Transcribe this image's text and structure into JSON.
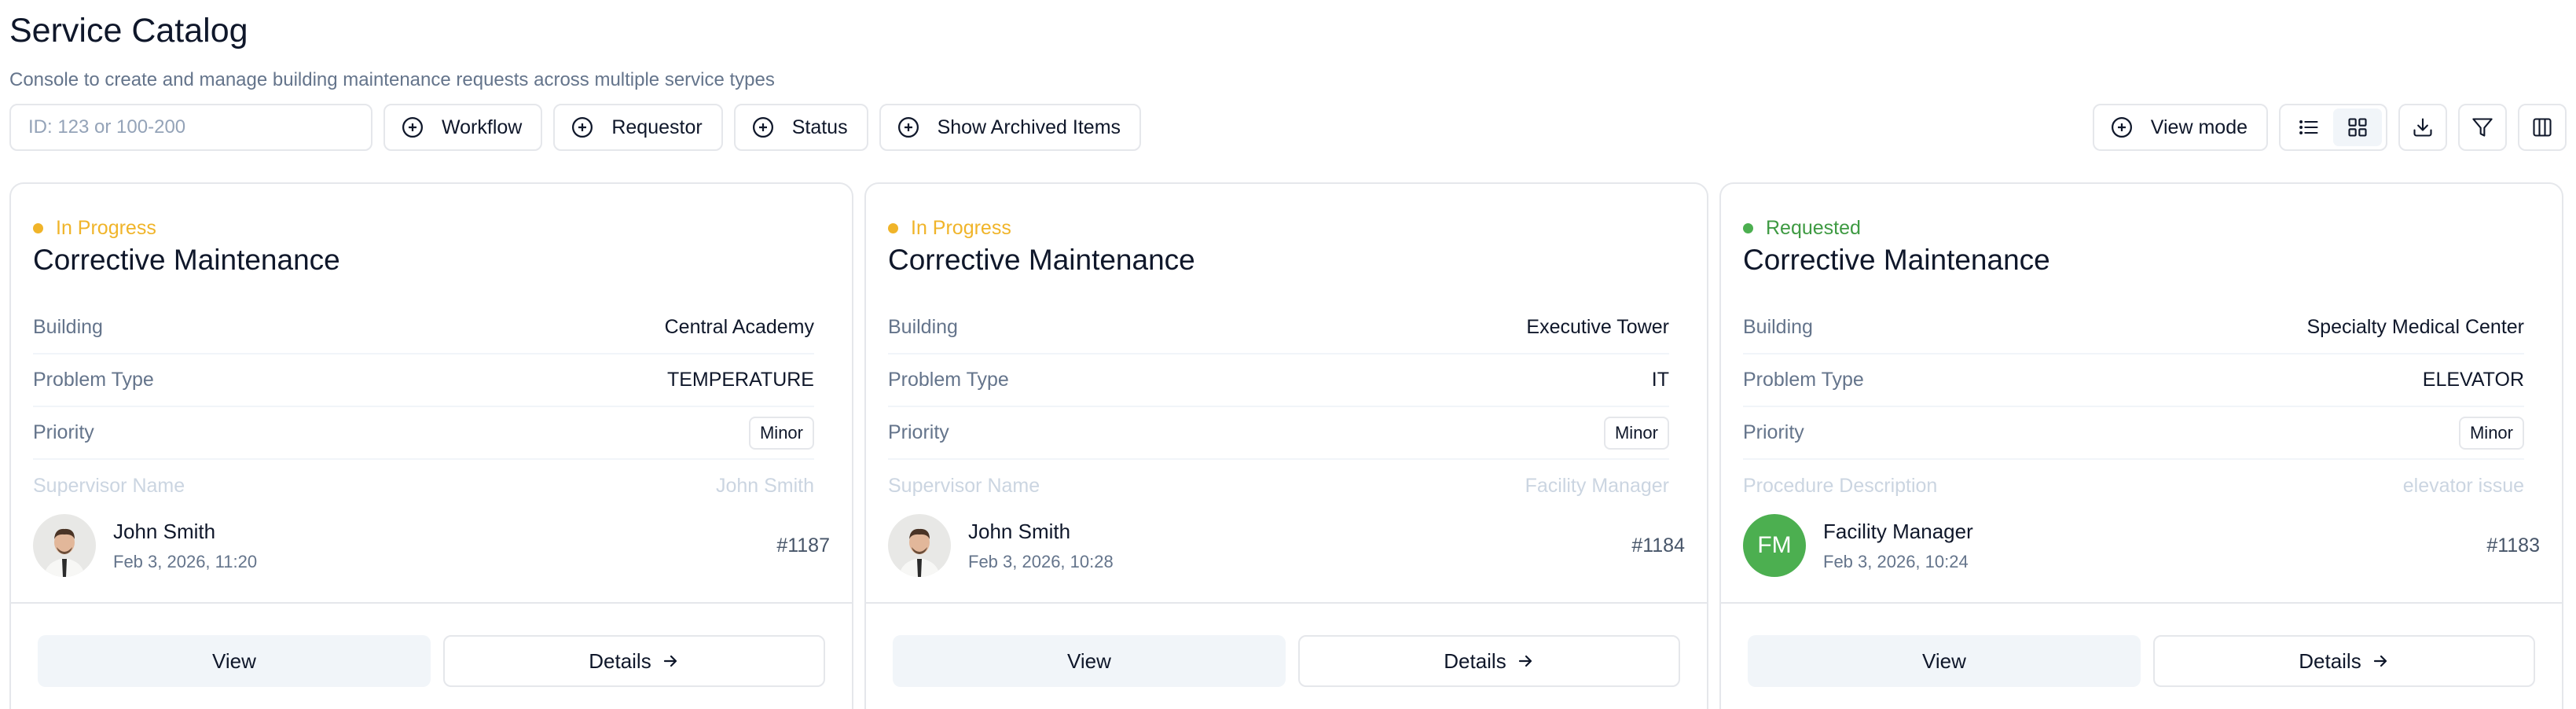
{
  "header": {
    "title": "Service Catalog",
    "subtitle": "Console to create and manage building maintenance requests across multiple service types"
  },
  "toolbar": {
    "search_placeholder": "ID: 123 or 100-200",
    "filters": [
      "Workflow",
      "Requestor",
      "Status",
      "Show Archived Items"
    ],
    "view_mode_label": "View mode",
    "active_view": "grid"
  },
  "cards": [
    {
      "status": "In Progress",
      "status_color": "#f0b429",
      "title": "Corrective Maintenance",
      "rows": [
        {
          "key": "Building",
          "value": "Central Academy"
        },
        {
          "key": "Problem Type",
          "value": "TEMPERATURE"
        },
        {
          "key": "Priority",
          "value": "Minor"
        },
        {
          "key": "Supervisor Name",
          "value": "John Smith"
        }
      ],
      "person": {
        "name": "John Smith",
        "date": "Feb 3, 2026, 11:20",
        "avatar": "photo"
      },
      "id": "#1187",
      "view_label": "View",
      "details_label": "Details"
    },
    {
      "status": "In Progress",
      "status_color": "#f0b429",
      "title": "Corrective Maintenance",
      "rows": [
        {
          "key": "Building",
          "value": "Executive Tower"
        },
        {
          "key": "Problem Type",
          "value": "IT"
        },
        {
          "key": "Priority",
          "value": "Minor"
        },
        {
          "key": "Supervisor Name",
          "value": "Facility Manager"
        }
      ],
      "person": {
        "name": "John Smith",
        "date": "Feb 3, 2026, 10:28",
        "avatar": "photo"
      },
      "id": "#1184",
      "view_label": "View",
      "details_label": "Details"
    },
    {
      "status": "Requested",
      "status_color": "#4caf50",
      "title": "Corrective Maintenance",
      "rows": [
        {
          "key": "Building",
          "value": "Specialty Medical Center"
        },
        {
          "key": "Problem Type",
          "value": "ELEVATOR"
        },
        {
          "key": "Priority",
          "value": "Minor"
        },
        {
          "key": "Procedure Description",
          "value": "elevator issue"
        }
      ],
      "person": {
        "name": "Facility Manager",
        "date": "Feb 3, 2026, 10:24",
        "avatar": "initials",
        "initials": "FM",
        "avatar_color": "#4caf50"
      },
      "id": "#1183",
      "view_label": "View",
      "details_label": "Details"
    }
  ]
}
